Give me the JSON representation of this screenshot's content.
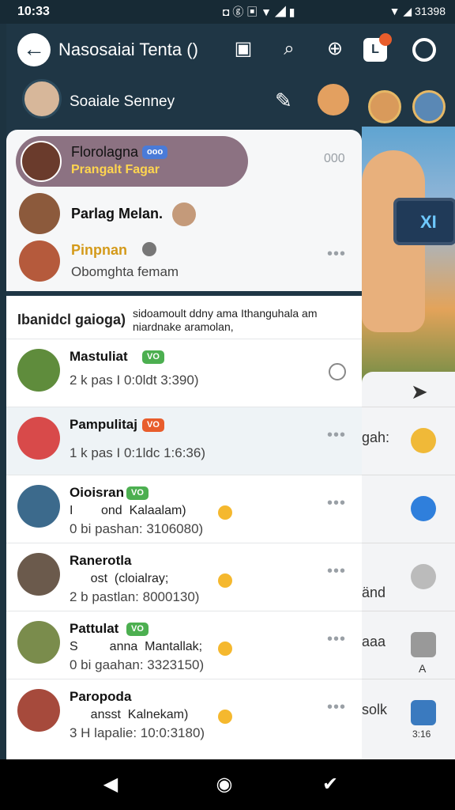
{
  "status": {
    "time": "10:33",
    "left_icons": "◘ ⓖ ▣ ▼ ◢ ▮",
    "right": "▼ ◢ 31398"
  },
  "app": {
    "title": "Nasosaiai Tenta ()"
  },
  "profile": {
    "name": "Soaiale Senney"
  },
  "highlighted": {
    "name": "Florolagna",
    "badge": "ooo",
    "sub": "Prangalt Fagar",
    "side": "000"
  },
  "row2": {
    "name": "Parlag Melan."
  },
  "row3": {
    "name": "Pinpnan",
    "sub": "Obomghta femam"
  },
  "section": {
    "heading": "Ibanidcl gaioga)",
    "desc": "sidoamoult ddny ama Ithanguhala am niardnake aramolan,"
  },
  "chats": [
    {
      "name": "Mastuliat",
      "badge": "VO",
      "badge_color": "#4caf50",
      "time": "2 k pas I 0:0ldt 3:390)"
    },
    {
      "name": "Pampulitaj",
      "badge": "VO",
      "badge_color": "#e85d2c",
      "time": "1 k pas I 0:1ldc 1:6:36)"
    },
    {
      "name": "Oioisran",
      "badge": "VO",
      "badge_color": "#4caf50",
      "mid": "I        ond  Kalaalam)",
      "time": "0 bi pashan: 3106080)"
    },
    {
      "name": "Ranerotla",
      "mid": "      ost  (cloialray;",
      "time": "2 b pastlan: 8000130)"
    },
    {
      "name": "Pattulat",
      "badge": "VO",
      "badge_color": "#4caf50",
      "mid": "S         anna  Mantallak;",
      "time": "0 bi gaahan: 3323150)"
    },
    {
      "name": "Paropoda",
      "mid": "      ansst  Kalnekam)",
      "time": "3 H lapalie: 10:0:3180)"
    }
  ],
  "right_panel": {
    "row1": "gah:",
    "row3": "änd",
    "row4": "aaa",
    "row4_sub": "A",
    "row5": "solk",
    "row5_sub": "3:16",
    "screen_text": "XI"
  },
  "colors": {
    "header": "#1f3645",
    "highlight": "#8c7282",
    "accent": "#4caf50"
  }
}
